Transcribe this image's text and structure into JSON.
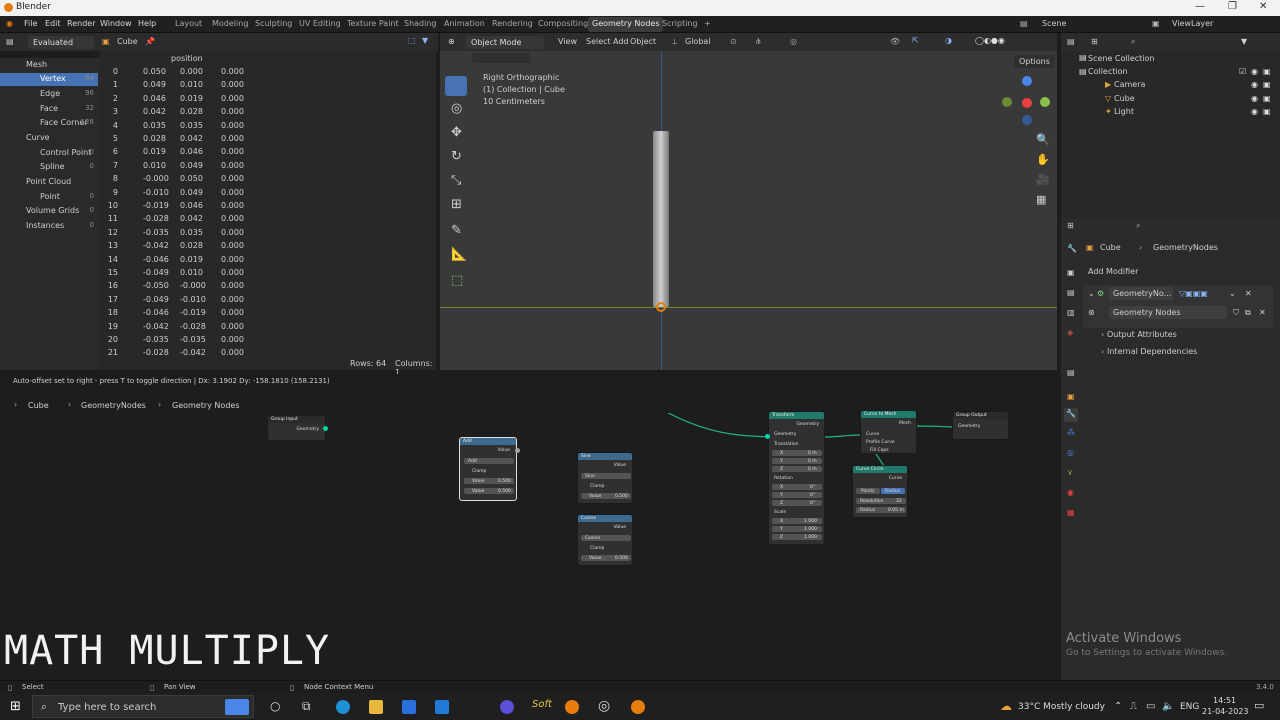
{
  "window": {
    "title": "Blender",
    "controls": [
      "—",
      "❐",
      "✕"
    ]
  },
  "menubar": {
    "items": [
      "File",
      "Edit",
      "Render",
      "Window",
      "Help"
    ],
    "workspaces": [
      "Layout",
      "Modeling",
      "Sculpting",
      "UV Editing",
      "Texture Paint",
      "Shading",
      "Animation",
      "Rendering",
      "Compositing",
      "Geometry Nodes",
      "Scripting"
    ],
    "add_tab": "+",
    "scene_label": "Scene",
    "view_layer": "ViewLayer"
  },
  "spreadsheet": {
    "mode": "Evaluated",
    "object": "Cube",
    "tree": [
      {
        "label": "Mesh",
        "count": ""
      },
      {
        "label": "Vertex",
        "count": "64"
      },
      {
        "label": "Edge",
        "count": "96"
      },
      {
        "label": "Face",
        "count": "32"
      },
      {
        "label": "Face Corner",
        "count": "128"
      },
      {
        "label": "Curve",
        "count": ""
      },
      {
        "label": "Control Point",
        "count": "0"
      },
      {
        "label": "Spline",
        "count": "0"
      },
      {
        "label": "Point Cloud",
        "count": ""
      },
      {
        "label": "Point",
        "count": "0"
      },
      {
        "label": "Volume Grids",
        "count": "0"
      },
      {
        "label": "Instances",
        "count": "0"
      }
    ],
    "column_header": "position",
    "rows": [
      [
        "0",
        "0.050",
        "0.000",
        "0.000"
      ],
      [
        "1",
        "0.049",
        "0.010",
        "0.000"
      ],
      [
        "2",
        "0.046",
        "0.019",
        "0.000"
      ],
      [
        "3",
        "0.042",
        "0.028",
        "0.000"
      ],
      [
        "4",
        "0.035",
        "0.035",
        "0.000"
      ],
      [
        "5",
        "0.028",
        "0.042",
        "0.000"
      ],
      [
        "6",
        "0.019",
        "0.046",
        "0.000"
      ],
      [
        "7",
        "0.010",
        "0.049",
        "0.000"
      ],
      [
        "8",
        "-0.000",
        "0.050",
        "0.000"
      ],
      [
        "9",
        "-0.010",
        "0.049",
        "0.000"
      ],
      [
        "10",
        "-0.019",
        "0.046",
        "0.000"
      ],
      [
        "11",
        "-0.028",
        "0.042",
        "0.000"
      ],
      [
        "12",
        "-0.035",
        "0.035",
        "0.000"
      ],
      [
        "13",
        "-0.042",
        "0.028",
        "0.000"
      ],
      [
        "14",
        "-0.046",
        "0.019",
        "0.000"
      ],
      [
        "15",
        "-0.049",
        "0.010",
        "0.000"
      ],
      [
        "16",
        "-0.050",
        "-0.000",
        "0.000"
      ],
      [
        "17",
        "-0.049",
        "-0.010",
        "0.000"
      ],
      [
        "18",
        "-0.046",
        "-0.019",
        "0.000"
      ],
      [
        "19",
        "-0.042",
        "-0.028",
        "0.000"
      ],
      [
        "20",
        "-0.035",
        "-0.035",
        "0.000"
      ],
      [
        "21",
        "-0.028",
        "-0.042",
        "0.000"
      ]
    ],
    "rows_label": "Rows: 64",
    "cols_label": "Columns: 1"
  },
  "viewport": {
    "mode": "Object Mode",
    "menus": [
      "View",
      "Select",
      "Add",
      "Object"
    ],
    "transform": "Global",
    "info": [
      "Right Orthographic",
      "(1) Collection | Cube",
      "10 Centimeters"
    ],
    "options": "Options"
  },
  "status_msg": "Auto-offset set to right - press T to toggle direction  |  Dx: 3.1902   Dy: -158.1810 (158.2131)",
  "node_editor": {
    "breadcrumb": [
      "Cube",
      "GeometryNodes",
      "Geometry Nodes"
    ],
    "nodes": {
      "group_input": {
        "title": "Group Input",
        "out": "Geometry"
      },
      "add": {
        "title": "Add",
        "out": "Value",
        "op": "Add",
        "clamp": "Clamp",
        "v1": "Value",
        "v1n": "0.500",
        "v2": "Value",
        "v2n": "0.500"
      },
      "sine": {
        "title": "Sine",
        "out": "Value",
        "op": "Sine",
        "clamp": "Clamp",
        "v": "Value",
        "vn": "0.500"
      },
      "cosine": {
        "title": "Cosine",
        "out": "Value",
        "op": "Cosine",
        "clamp": "Clamp",
        "v": "Value",
        "vn": "0.500"
      },
      "transform": {
        "title": "Transform",
        "geo": "Geometry",
        "translation": "Translation",
        "rotation": "Rotation",
        "scale": "Scale",
        "x": "X",
        "y": "Y",
        "z": "Z",
        "tx": "0 m",
        "ty": "0 m",
        "tz": "0 m",
        "rx": "0°",
        "ry": "0°",
        "rz": "0°",
        "sx": "1.000",
        "sy": "1.000",
        "sz": "1.000"
      },
      "curve_to_mesh": {
        "title": "Curve to Mesh",
        "mesh": "Mesh",
        "curve": "Curve",
        "profile": "Profile Curve",
        "fill": "Fill Caps"
      },
      "curve_circle": {
        "title": "Curve Circle",
        "curve": "Curve",
        "points": "Points",
        "radius_mode": "Radius",
        "resolution": "Resolution",
        "res_val": "32",
        "radius": "Radius",
        "rad_val": "0.05 m"
      },
      "group_output": {
        "title": "Group Output",
        "geo": "Geometry"
      }
    }
  },
  "outliner": {
    "items": [
      "Scene Collection",
      "Collection",
      "Camera",
      "Cube",
      "Light"
    ]
  },
  "properties": {
    "breadcrumb": [
      "Cube",
      "GeometryNodes"
    ],
    "add_modifier": "Add Modifier",
    "modifier_name": "GeometryNo...",
    "node_group": "Geometry Nodes",
    "sections": [
      "Output Attributes",
      "Internal Dependencies"
    ]
  },
  "caption": "MATH MULTIPLY",
  "watermark": {
    "line1": "Activate Windows",
    "line2": "Go to Settings to activate Windows."
  },
  "statusbar": {
    "select": "Select",
    "pan": "Pan View",
    "context": "Node Context Menu",
    "version": "3.4.0"
  },
  "taskbar": {
    "search": "Type here to search",
    "weather": "33°C  Mostly cloudy",
    "lang": "ENG",
    "time": "14:51",
    "date": "21-04-2023"
  },
  "colors": {
    "selected": "#4772b3",
    "header_math": "#3c6b8f",
    "header_geo": "#1f7a6b",
    "noodle": "#22b38a"
  }
}
